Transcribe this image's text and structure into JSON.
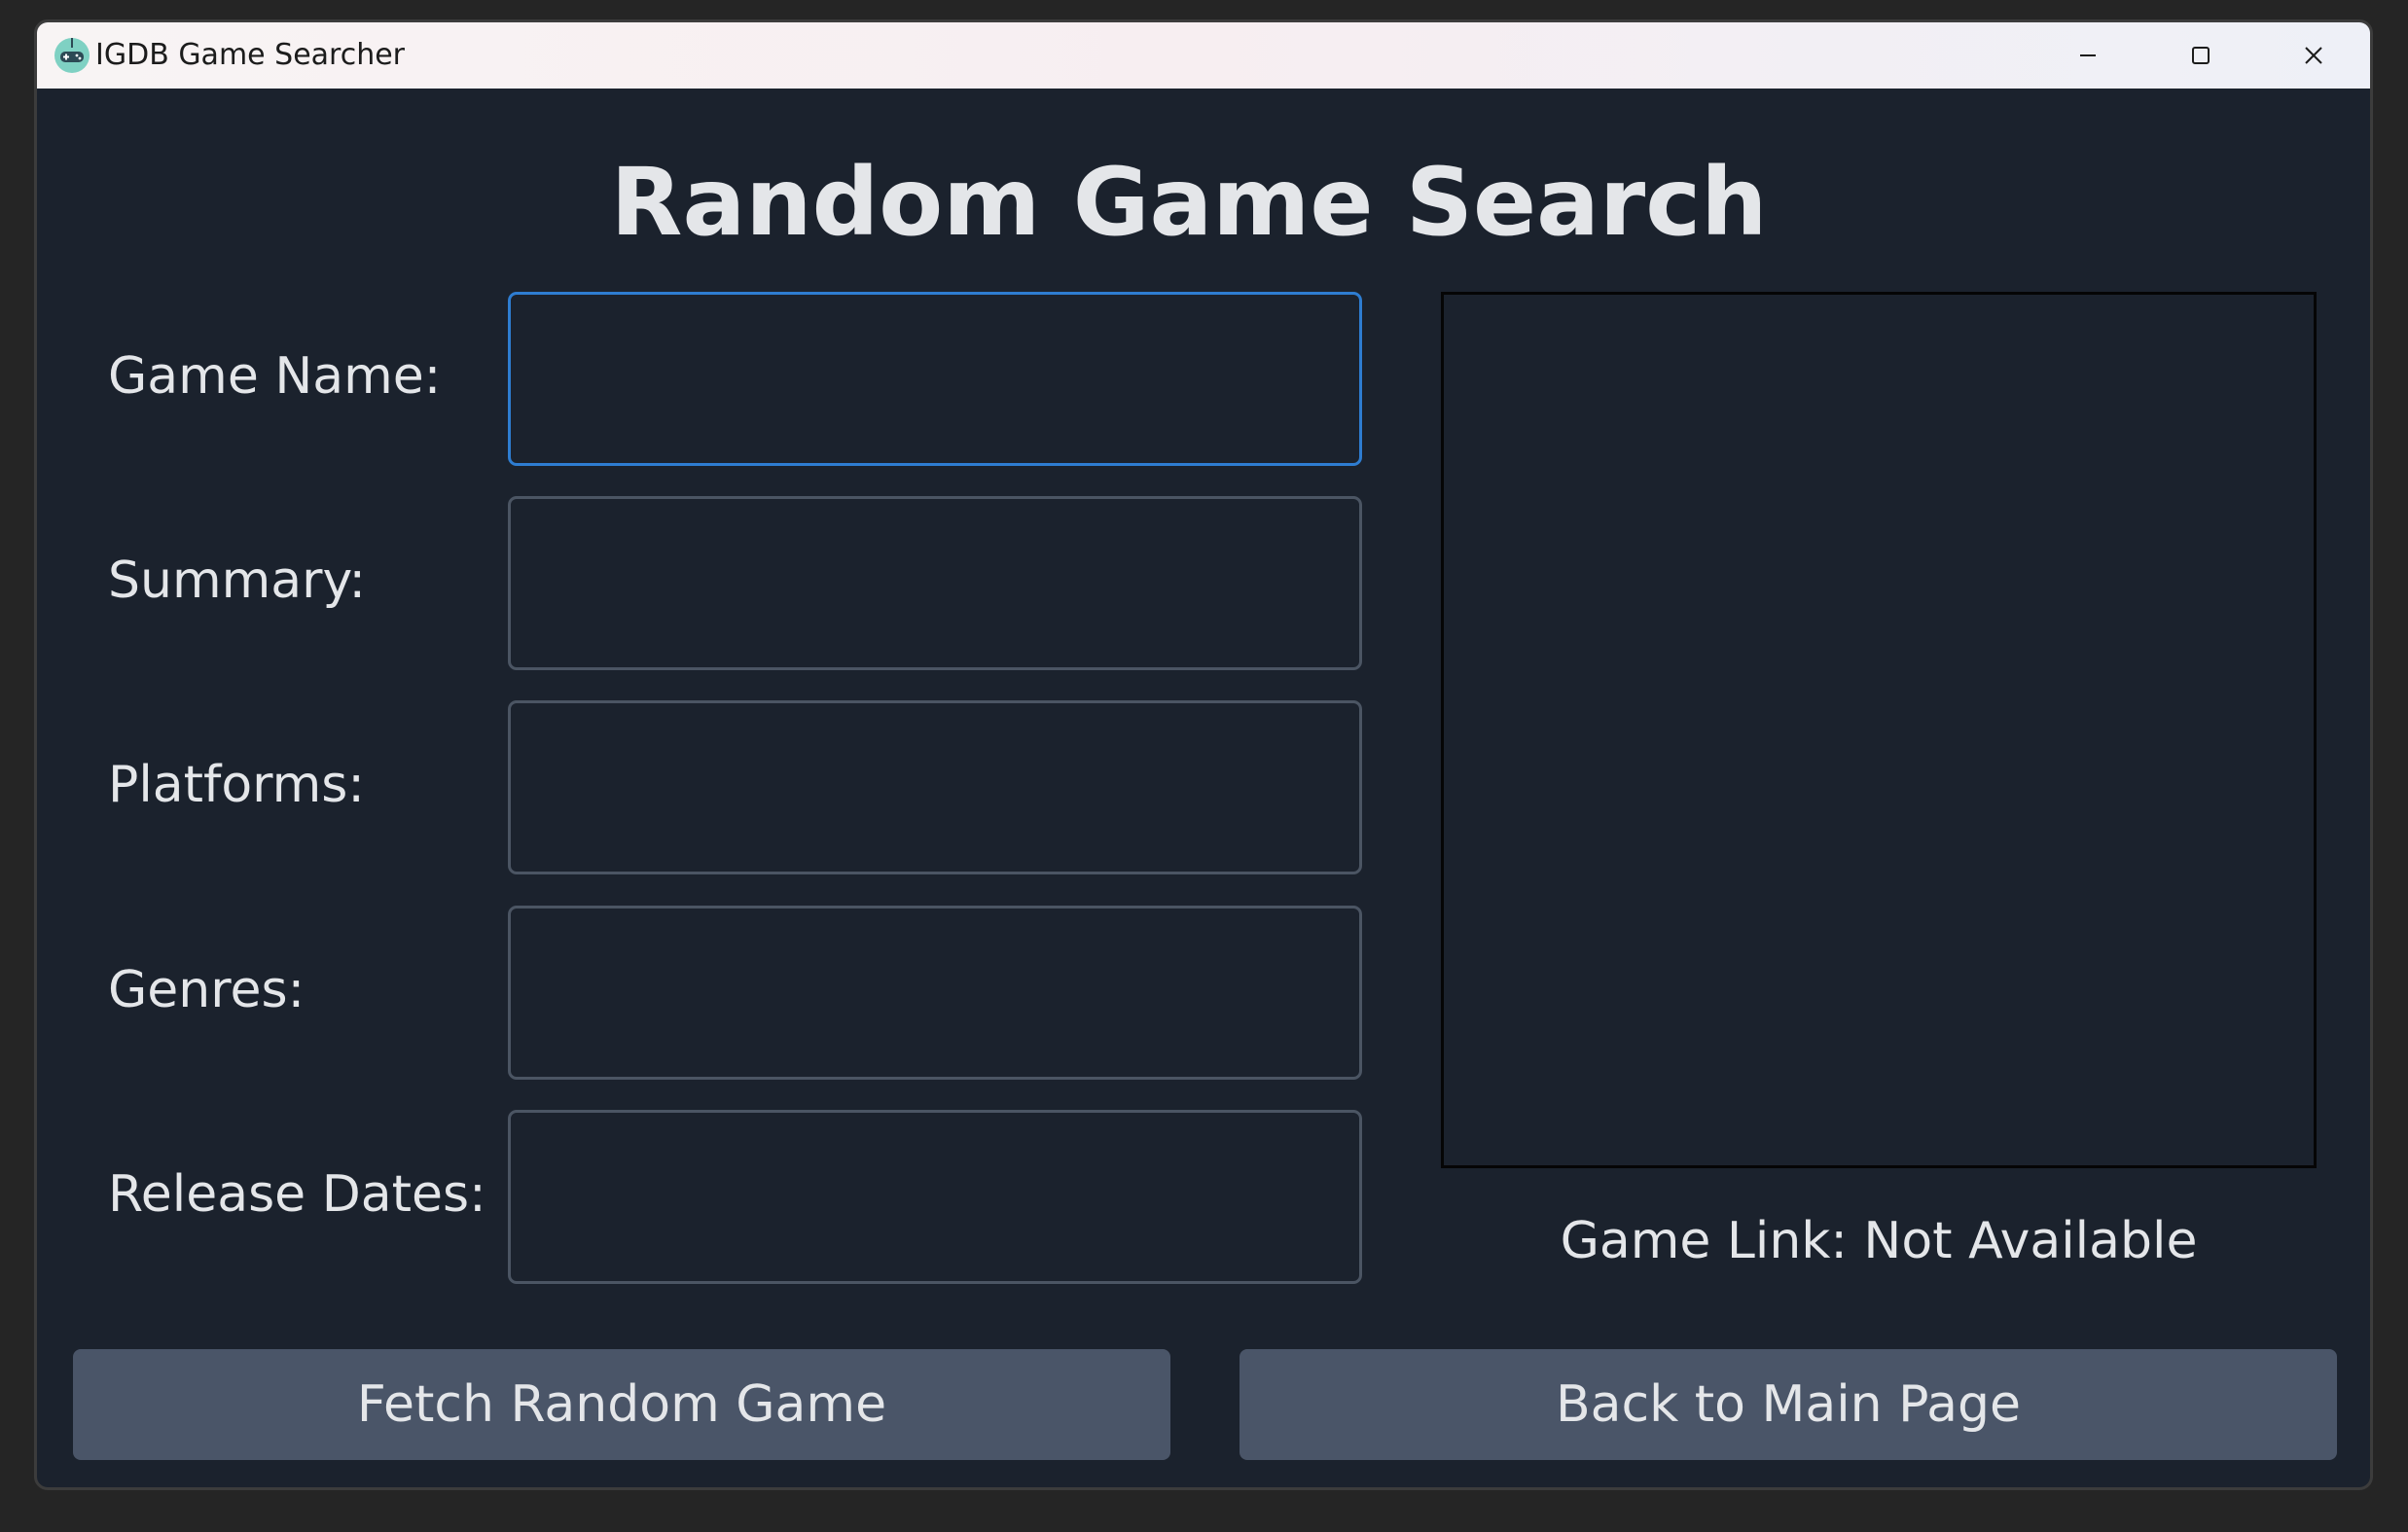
{
  "window": {
    "title": "IGDB Game Searcher",
    "icon": "gamepad-icon",
    "controls": [
      "minimize-icon",
      "maximize-icon",
      "close-icon"
    ]
  },
  "page": {
    "title": "Random Game Search"
  },
  "fields": [
    {
      "label": "Game Name:",
      "value": "",
      "focused": true
    },
    {
      "label": "Summary:",
      "value": ""
    },
    {
      "label": "Platforms:",
      "value": ""
    },
    {
      "label": "Genres:",
      "value": ""
    },
    {
      "label": "Release Dates:",
      "value": ""
    }
  ],
  "image_panel": {
    "content": ""
  },
  "game_link": {
    "text": "Game Link: Not Available"
  },
  "buttons": {
    "fetch": "Fetch Random Game",
    "back": "Back to Main Page"
  },
  "colors": {
    "background": "#1b222d",
    "text": "#e4e6e9",
    "input_border": "#4b5563",
    "focus_border": "#2e7dd1",
    "button_bg": "#4a5568",
    "app_icon": "#7fd1c3"
  }
}
